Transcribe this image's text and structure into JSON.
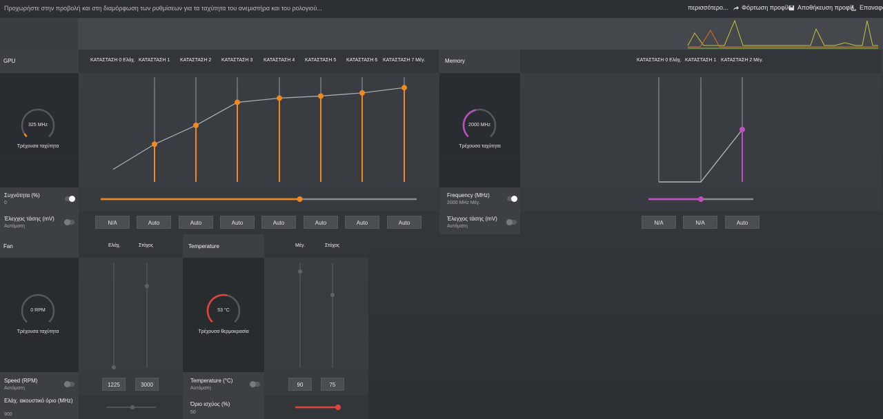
{
  "topbar": {
    "hint": "Προχωρήστε στην προβολή και στη διαμόρφωση των ρυθμίσεων για τα ταχύτητα του ανεμιστήρα και του ρολογιού...",
    "more": "περισσότερο...",
    "load_profile": "Φόρτωση προφίλ",
    "save_profile": "Αποθήκευση προφίλ",
    "reset": "Επαναφορά"
  },
  "colors": {
    "gpu_accent": "#f08a1c",
    "mem_accent": "#c04fc4",
    "temp_accent": "#e2443a"
  },
  "gpu": {
    "title": "GPU",
    "states": [
      "ΚΑΤΑΣΤΑΣΗ 0 Ελάχ.",
      "ΚΑΤΑΣΤΑΣΗ 1",
      "ΚΑΤΑΣΤΑΣΗ 2",
      "ΚΑΤΑΣΤΑΣΗ 3",
      "ΚΑΤΑΣΤΑΣΗ 4",
      "ΚΑΤΑΣΤΑΣΗ 5",
      "ΚΑΤΑΣΤΑΣΗ 6",
      "ΚΑΤΑΣΤΑΣΗ 7 Μέγ."
    ],
    "state_levels": [
      0.12,
      0.36,
      0.54,
      0.76,
      0.8,
      0.82,
      0.85,
      0.9
    ],
    "gauge_value": "325 MHz",
    "gauge_level": 0.05,
    "gauge_label": "Τρέχουσα ταχύτητα",
    "freq_label": "Συχνότητα (%)",
    "freq_value": "0",
    "freq_slider": 0.63,
    "volt_label": "Έλεγχος τάσης (mV)",
    "volt_value": "Αυτόματη",
    "volt_buttons": [
      "N/A",
      "Auto",
      "Auto",
      "Auto",
      "Auto",
      "Auto",
      "Auto",
      "Auto"
    ]
  },
  "memory": {
    "title": "Memory",
    "states": [
      "ΚΑΤΑΣΤΑΣΗ 0 Ελάχ.",
      "ΚΑΤΑΣΤΑΣΗ 1",
      "ΚΑΤΑΣΤΑΣΗ 2 Μέγ."
    ],
    "gauge_value": "2000 MHz",
    "gauge_level": 0.45,
    "gauge_label": "Τρέχουσα ταχύτητα",
    "freq_label": "Frequency (MHz)",
    "freq_value": "2000 MHz Μέγ.",
    "freq_slider": 0.5,
    "volt_label": "Έλεγχος τάσης (mV)",
    "volt_value": "Αυτόματη",
    "volt_buttons": [
      "N/A",
      "N/A",
      "Auto"
    ]
  },
  "fan": {
    "title": "Fan",
    "col_min": "Ελάχ.",
    "col_target": "Στόχος",
    "gauge_value": "0 RPM",
    "gauge_level": 0,
    "gauge_label": "Τρέχουσα ταχύτητα",
    "speed_label": "Speed (RPM)",
    "speed_value": "Αυτόματη",
    "speed_min": "1225",
    "speed_target": "3000",
    "acoustic_label": "Ελάχ. ακουστικό όριο (MHz)",
    "acoustic_value": "900"
  },
  "temperature": {
    "title": "Temperature",
    "col_max": "Μέγ.",
    "col_target": "Στόχος",
    "gauge_value": "53 °C",
    "gauge_level": 0.55,
    "gauge_label": "Τρέχουσα θερμοκρασία",
    "temp_label": "Temperature (°C)",
    "temp_value": "Αυτόματη",
    "temp_max": "90",
    "temp_target": "75",
    "power_label": "Όριο ισχύος (%)",
    "power_value": "50",
    "power_slider": 1
  }
}
